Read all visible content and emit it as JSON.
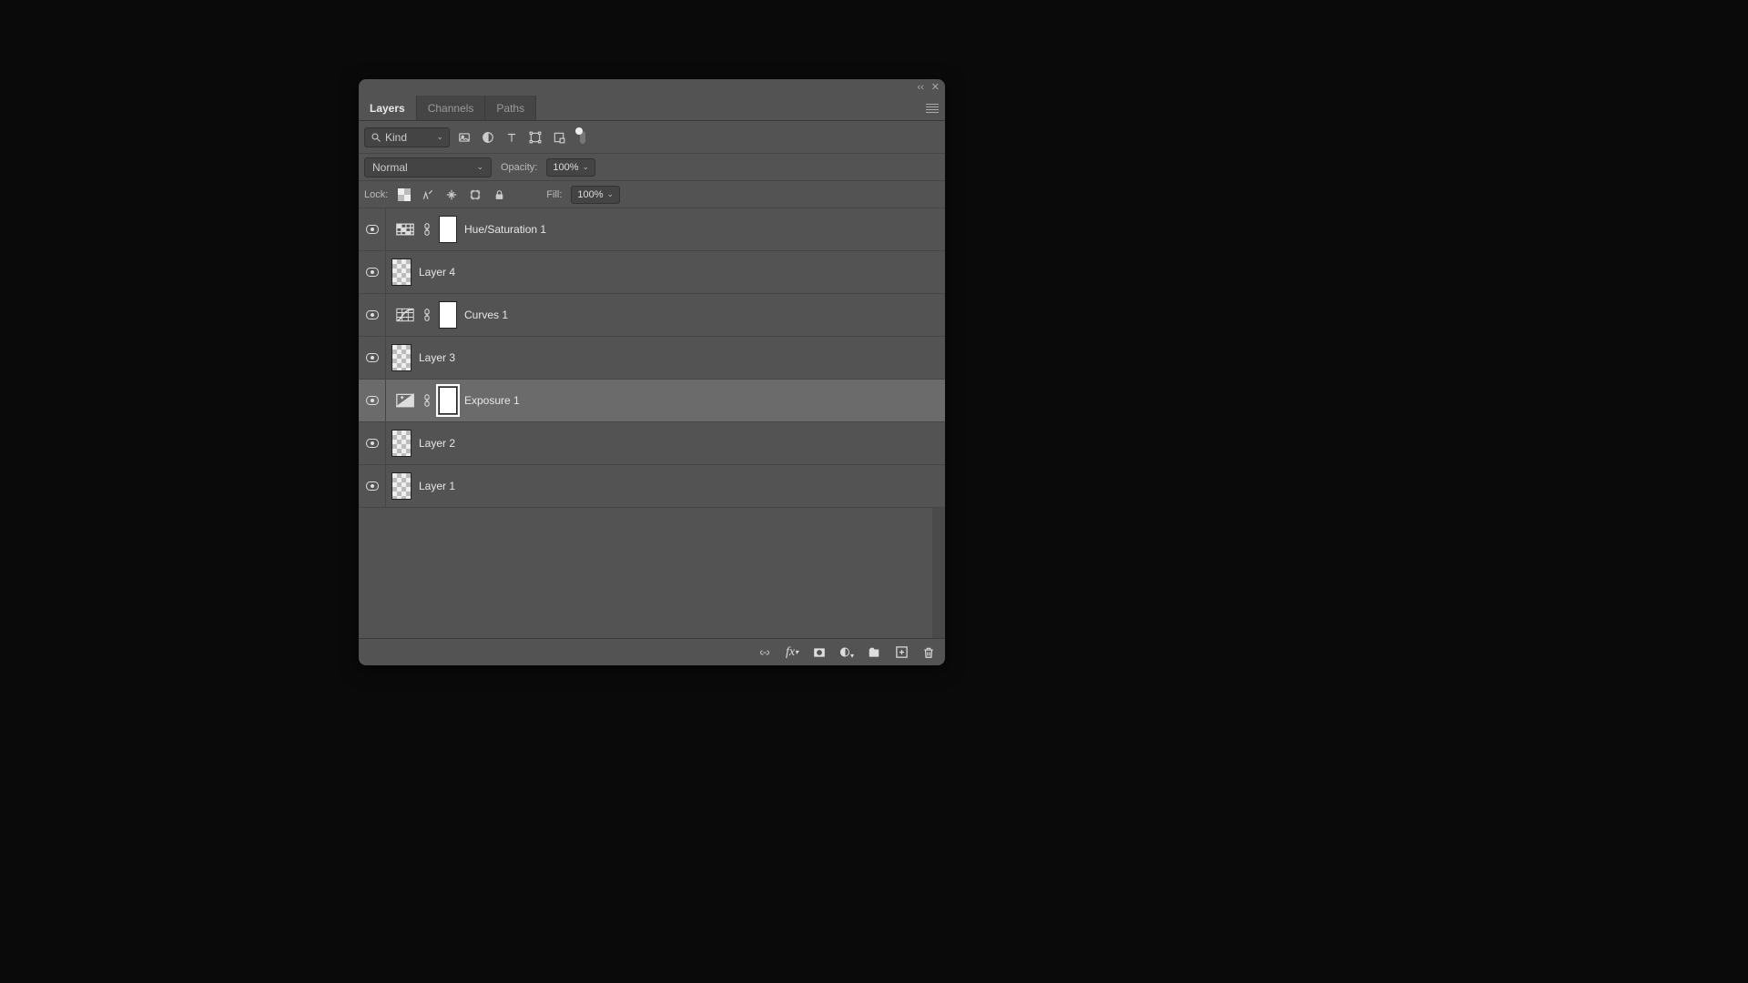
{
  "tabs": {
    "layers": "Layers",
    "channels": "Channels",
    "paths": "Paths",
    "active": "layers"
  },
  "filter": {
    "kind_label": "Kind"
  },
  "blend": {
    "mode": "Normal",
    "opacity_label": "Opacity:",
    "opacity_value": "100%"
  },
  "lock": {
    "label": "Lock:",
    "fill_label": "Fill:",
    "fill_value": "100%"
  },
  "layers": [
    {
      "name": "Hue/Saturation 1",
      "type": "adjustment",
      "adjustment": "hue-saturation",
      "selected": false
    },
    {
      "name": "Layer 4",
      "type": "pixel",
      "selected": false
    },
    {
      "name": "Curves 1",
      "type": "adjustment",
      "adjustment": "curves",
      "selected": false
    },
    {
      "name": "Layer 3",
      "type": "pixel",
      "selected": false
    },
    {
      "name": "Exposure 1",
      "type": "adjustment",
      "adjustment": "exposure",
      "selected": true
    },
    {
      "name": "Layer 2",
      "type": "pixel",
      "selected": false
    },
    {
      "name": "Layer 1",
      "type": "pixel",
      "selected": false
    }
  ]
}
